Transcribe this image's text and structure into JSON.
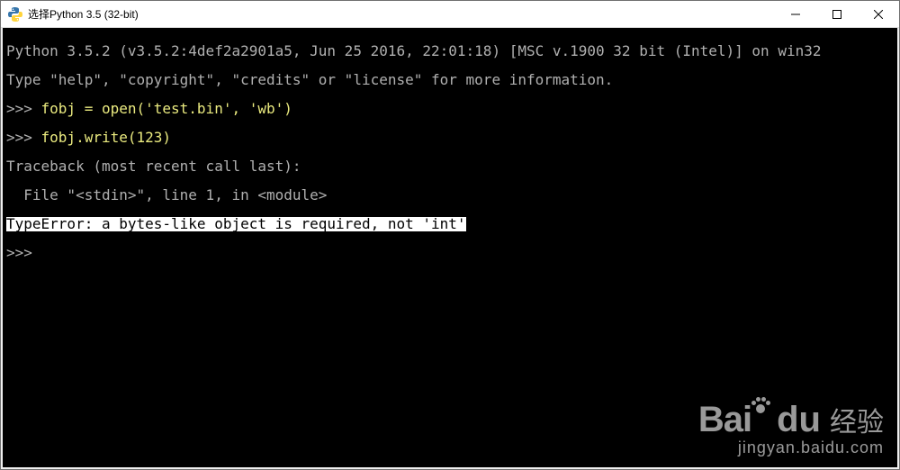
{
  "window": {
    "title": "选择Python 3.5 (32-bit)"
  },
  "console": {
    "banner1": "Python 3.5.2 (v3.5.2:4def2a2901a5, Jun 25 2016, 22:01:18) [MSC v.1900 32 bit (Intel)] on win32",
    "banner2": "Type \"help\", \"copyright\", \"credits\" or \"license\" for more information.",
    "prompt": ">>> ",
    "cmd1": "fobj = open('test.bin', 'wb')",
    "cmd2": "fobj.write(123)",
    "trace1": "Traceback (most recent call last):",
    "trace2": "  File \"<stdin>\", line 1, in <module>",
    "error": "TypeError: a bytes-like object is required, not 'int'",
    "prompt2": ">>>"
  },
  "watermark": {
    "brand1": "Bai",
    "brand2": "du",
    "brand3": "经验",
    "url": "jingyan.baidu.com"
  }
}
